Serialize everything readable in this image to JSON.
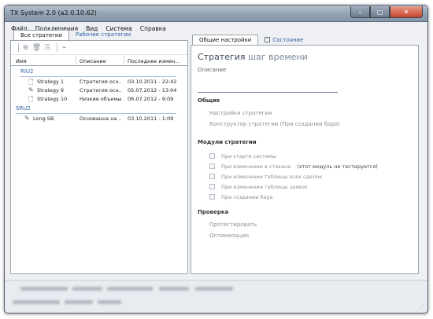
{
  "window": {
    "title": "TX System 2.0 (a2.0.10.62)",
    "controls": {
      "minimize": "–",
      "maximize": "□",
      "close": "✕"
    }
  },
  "menu": [
    "Файл",
    "Подключения",
    "Вид",
    "Система",
    "Справка"
  ],
  "left_tabs": [
    "Все стратегии",
    "Рабочие стратегии"
  ],
  "toolbar_icons": [
    "add-icon",
    "delete-icon",
    "copy-icon",
    "link-icon"
  ],
  "grid": {
    "columns": [
      "Имя",
      "Описание",
      "Последнее измен..."
    ],
    "groups": [
      {
        "name": "RIU2",
        "rows": [
          {
            "name": "Strategy 1",
            "description": "Стратегия осн...",
            "modified": "03.10.2011 - 22:42",
            "icon": "document-icon"
          },
          {
            "name": "Strategy 9",
            "description": "Стратегия осн...",
            "modified": "05.07.2012 - 13:04",
            "icon": "pencil-icon"
          },
          {
            "name": "Strategy 10",
            "description": "Низкие объемы",
            "modified": "06.07.2012 - 9:09",
            "icon": "document-icon"
          }
        ]
      },
      {
        "name": "SRU2",
        "rows": [
          {
            "name": "Long SB",
            "description": "Основанна на ...",
            "modified": "03.10.2011 - 1:09",
            "icon": "pencil-icon"
          }
        ]
      }
    ]
  },
  "right_tabs": [
    "Общие настройки",
    "Состояние"
  ],
  "settings": {
    "title_main": "Стратегия",
    "title_sub": "шаг времени",
    "description_label": "Описание",
    "general_header": "Общие",
    "general_links": [
      "Настройки стратегии",
      "Конструктор стратегии (При создании бара)"
    ],
    "modules_header": "Модули стратегии",
    "modules": [
      {
        "label": "При старте системы",
        "note": ""
      },
      {
        "label": "При изменении в стакане",
        "note": "(этот модуль не тестируется)"
      },
      {
        "label": "При изменении таблицы всех сделок",
        "note": ""
      },
      {
        "label": "При изменении таблицы заявок",
        "note": ""
      },
      {
        "label": "При создании бара",
        "note": ""
      }
    ],
    "check_header": "Проверка",
    "check_links": [
      "Протестировать",
      "Оптимизация"
    ]
  }
}
